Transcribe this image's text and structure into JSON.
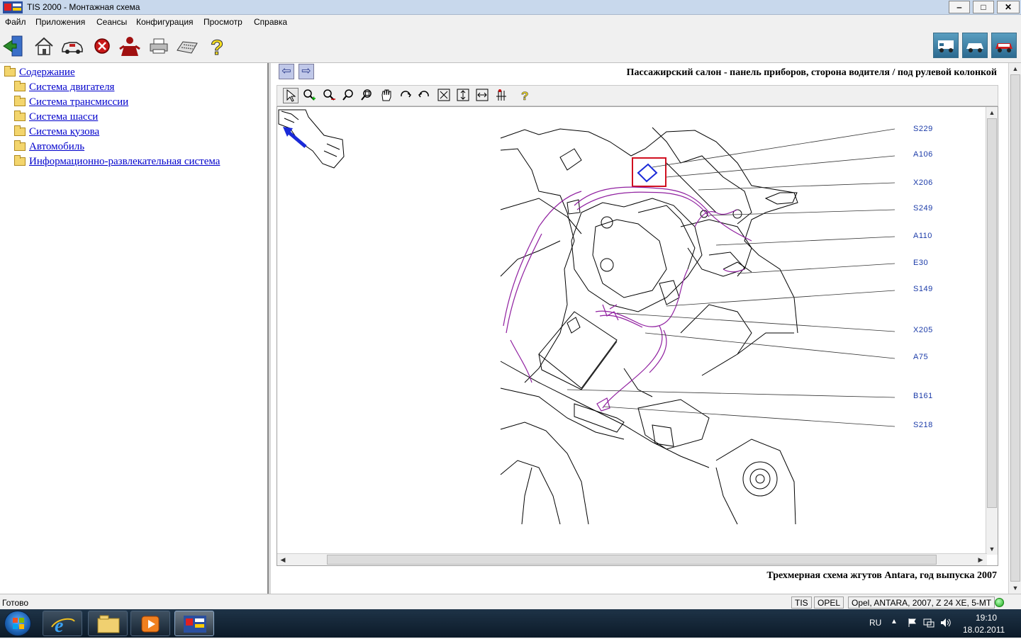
{
  "window": {
    "brand": "TIS 2000",
    "title_rest": " - Монтажная схема",
    "min": "‒",
    "max": "□",
    "close": "✕"
  },
  "menu": [
    "Файл",
    "Приложения",
    "Сеансы",
    "Конфигурация",
    "Просмотр",
    "Справка"
  ],
  "toolbar_icons": [
    "exit-icon",
    "home-icon",
    "vehicle-icon",
    "stop-icon",
    "user-icon",
    "print-icon",
    "keyboard-icon",
    "help-icon"
  ],
  "toolbar_right_icons": [
    "vehicle-diag-1-icon",
    "vehicle-diag-2-icon",
    "vehicle-diag-3-icon"
  ],
  "tree": {
    "root": "Содержание",
    "items": [
      "Система двигателя",
      "Система трансмиссии",
      "Система шасси",
      "Система кузова",
      "Автомобиль",
      "Информационно-развлекательная система"
    ]
  },
  "diagram": {
    "title": "Пассажирский салон - панель приборов, сторона водителя / под рулевой колонкой",
    "footer": "Трехмерная схема жгутов Antara, год выпуска 2007",
    "labels": [
      "S229",
      "A106",
      "X206",
      "S249",
      "A110",
      "E30",
      "S149",
      "X205",
      "A75",
      "B161",
      "S218"
    ],
    "nav_back": "⇦",
    "nav_forward": "⇨"
  },
  "view_tools": [
    "select-icon",
    "zoom-in-icon",
    "zoom-out-icon",
    "zoom-icon",
    "zoom-window-icon",
    "pan-icon",
    "rotate-cw-icon",
    "rotate-ccw-icon",
    "fit-all-icon",
    "fit-height-icon",
    "fit-width-icon",
    "components-icon",
    "help-icon"
  ],
  "status": {
    "text": "Готово",
    "cell_system": "TIS",
    "cell_make": "OPEL",
    "cell_vehicle": "Opel, ANTARA, 2007, Z 24 XE, 5-MT"
  },
  "taskbar": {
    "lang": "RU",
    "time": "19:10",
    "date": "18.02.2011"
  },
  "colors": {
    "highlight_box": "#d01020",
    "wire": "#9020a0",
    "label": "#1a3aa8",
    "pointer_arrow": "#1a2ad8"
  }
}
